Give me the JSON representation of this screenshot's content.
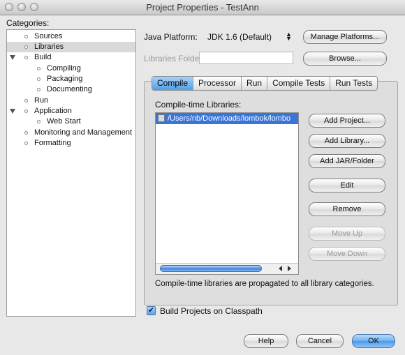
{
  "window": {
    "title": "Project Properties - TestAnn"
  },
  "categories": {
    "label": "Categories:",
    "items": [
      {
        "label": "Sources",
        "level": 1,
        "expand": false
      },
      {
        "label": "Libraries",
        "level": 1,
        "expand": false,
        "selected": true
      },
      {
        "label": "Build",
        "level": 1,
        "expand": true
      },
      {
        "label": "Compiling",
        "level": 2,
        "expand": false
      },
      {
        "label": "Packaging",
        "level": 2,
        "expand": false
      },
      {
        "label": "Documenting",
        "level": 2,
        "expand": false
      },
      {
        "label": "Run",
        "level": 1,
        "expand": false
      },
      {
        "label": "Application",
        "level": 1,
        "expand": true
      },
      {
        "label": "Web Start",
        "level": 2,
        "expand": false
      },
      {
        "label": "Monitoring and Management",
        "level": 1,
        "expand": false
      },
      {
        "label": "Formatting",
        "level": 1,
        "expand": false
      }
    ]
  },
  "platform": {
    "label": "Java Platform:",
    "value": "JDK 1.6 (Default)",
    "manage_button": "Manage Platforms..."
  },
  "libraries_folder": {
    "label": "Libraries Folder:",
    "value": "",
    "browse_button": "Browse..."
  },
  "tabs": [
    "Compile",
    "Processor",
    "Run",
    "Compile Tests",
    "Run Tests"
  ],
  "active_tab": "Compile",
  "compile": {
    "list_label": "Compile-time Libraries:",
    "libraries": [
      "/Users/nb/Downloads/lombok/lombo"
    ],
    "note": "Compile-time libraries are propagated to all library categories."
  },
  "actions": {
    "add_project": "Add Project...",
    "add_library": "Add Library...",
    "add_jar": "Add JAR/Folder",
    "edit": "Edit",
    "remove": "Remove",
    "move_up": "Move Up",
    "move_down": "Move Down"
  },
  "build_on_classpath": {
    "label": "Build Projects on Classpath",
    "checked": true
  },
  "footer": {
    "help": "Help",
    "cancel": "Cancel",
    "ok": "OK"
  }
}
